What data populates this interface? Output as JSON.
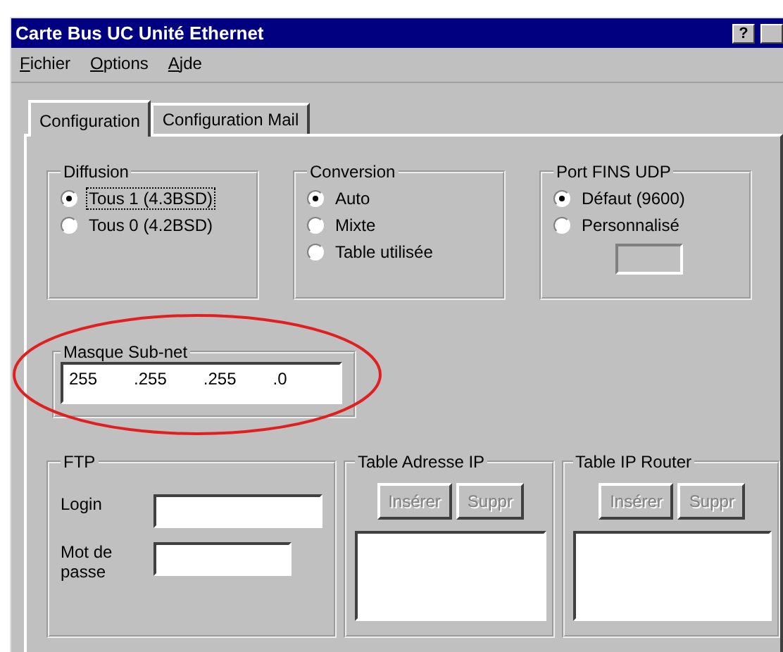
{
  "window": {
    "title": "Carte Bus UC Unité Ethernet",
    "help_button": "?"
  },
  "menu": [
    "Fichier",
    "Options",
    "Ajde"
  ],
  "tabs": [
    {
      "label": "Configuration",
      "selected": true
    },
    {
      "label": "Configuration Mail",
      "selected": false
    }
  ],
  "radio_groups": [
    {
      "title": "Diffusion",
      "options": [
        {
          "label": "Tous 1 (4.3BSD)",
          "selected": true,
          "focused": true
        },
        {
          "label": "Tous 0 (4.2BSD)",
          "selected": false,
          "focused": false
        }
      ]
    },
    {
      "title": "Conversion",
      "options": [
        {
          "label": "Auto",
          "selected": true,
          "focused": false
        },
        {
          "label": "Mixte",
          "selected": false,
          "focused": false
        },
        {
          "label": "Table utilisée",
          "selected": false,
          "focused": false
        }
      ]
    },
    {
      "title": "Port FINS UDP",
      "options": [
        {
          "label": "Défaut (9600)",
          "selected": true,
          "focused": false
        },
        {
          "label": "Personnalisé",
          "selected": false,
          "focused": false
        }
      ],
      "custom_field": {
        "disabled": true
      }
    }
  ],
  "subnet_mask": {
    "title": "Masque Sub-net",
    "octets": [
      "255",
      ".255",
      ".255",
      ".0"
    ],
    "highlighted": true
  },
  "ftp": {
    "title": "FTP",
    "fields": [
      {
        "label": "Login"
      },
      {
        "label": "Mot de passe"
      }
    ]
  },
  "tables": [
    {
      "title": "Table Adresse IP",
      "buttons": [
        {
          "label": "Insérer",
          "disabled": true
        },
        {
          "label": "Suppr",
          "disabled": true
        }
      ]
    },
    {
      "title": "Table IP Router",
      "buttons": [
        {
          "label": "Insérer",
          "disabled": true
        },
        {
          "label": "Suppr",
          "disabled": true
        }
      ]
    }
  ]
}
